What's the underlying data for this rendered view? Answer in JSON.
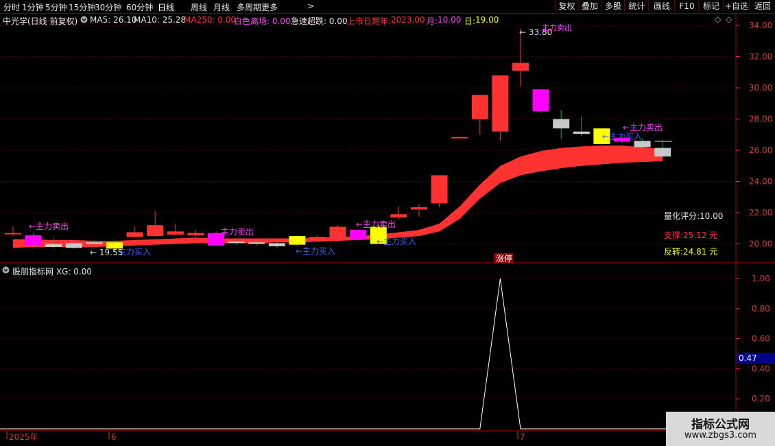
{
  "toolbar": {
    "tabs": [
      "分时",
      "1分钟",
      "5分钟",
      "15分钟",
      "30分钟",
      "60分钟",
      "日线",
      "周线",
      "月线",
      "多周期",
      "更多"
    ],
    "active": "日线",
    "more_arrow": ">",
    "buttons": [
      "复权",
      "叠加",
      "多股",
      "统计",
      "画线",
      "F10",
      "标记",
      "+自选",
      "返回"
    ]
  },
  "info": {
    "stock": "中光学(日线 前复权)",
    "ma5": "MA5: 26.10",
    "ma10": "MA10: 25.28",
    "ma250": "MA250: 0.00",
    "white_exit": "白色离场: 0.00",
    "sharp_drop": "急速超跌: 0.00",
    "listing_label": "上市日期年:",
    "listing_year": "2023.00",
    "month_label": "月:",
    "month": "10.00",
    "day_label": "日:",
    "day": "19.00"
  },
  "colors": {
    "up": "#ff3232",
    "down": "#00c0c0",
    "magenta": "#ff00ff",
    "yellow": "#ffff00",
    "gray": "#c8c8c8",
    "band": "#ff3232",
    "grid": "#8b0000",
    "axis_text": "#d23c3c",
    "label_magenta": "#ff40ff",
    "label_blue": "#3a5bff"
  },
  "main_axis": {
    "ticks": [
      "34.00",
      "32.00",
      "30.00",
      "28.00",
      "26.00",
      "24.00",
      "22.00",
      "20.00"
    ]
  },
  "indicator_axis": {
    "ticks": [
      "1.00",
      "0.80",
      "0.60",
      "0.40",
      "0.20"
    ],
    "current": "0.47"
  },
  "right_panel": {
    "score": "量化评分:10.00",
    "support": "支撑:25.12 元",
    "reversal": "反转:24.81 元"
  },
  "annotations": {
    "high": "33.80",
    "low": "19.55",
    "zhangting": "涨停",
    "sell": "←主力卖出",
    "buy": "←主力买入",
    "sell_top": "主力卖出"
  },
  "candles": [
    {
      "o": 20.7,
      "h": 21.1,
      "l": 20.55,
      "c": 20.7,
      "type": "flat"
    },
    {
      "o": 19.9,
      "h": 20.7,
      "l": 19.75,
      "c": 20.55,
      "type": "magenta"
    },
    {
      "o": 20.0,
      "h": 20.4,
      "l": 19.7,
      "c": 19.8,
      "type": "gray"
    },
    {
      "o": 20.05,
      "h": 20.15,
      "l": 19.7,
      "c": 19.75,
      "type": "gray"
    },
    {
      "o": 20.1,
      "h": 20.25,
      "l": 19.95,
      "c": 20.0,
      "type": "gray"
    },
    {
      "o": 19.7,
      "h": 20.3,
      "l": 19.55,
      "c": 20.1,
      "type": "yellow"
    },
    {
      "o": 20.45,
      "h": 21.1,
      "l": 20.4,
      "c": 20.75,
      "type": "flat"
    },
    {
      "o": 20.5,
      "h": 22.1,
      "l": 20.45,
      "c": 21.2,
      "type": "up"
    },
    {
      "o": 20.6,
      "h": 21.3,
      "l": 20.55,
      "c": 20.8,
      "type": "up"
    },
    {
      "o": 20.55,
      "h": 20.9,
      "l": 20.45,
      "c": 20.7,
      "type": "up"
    },
    {
      "o": 19.9,
      "h": 20.8,
      "l": 19.85,
      "c": 20.7,
      "type": "magenta"
    },
    {
      "o": 20.05,
      "h": 20.3,
      "l": 19.95,
      "c": 20.15,
      "type": "gray"
    },
    {
      "o": 20.0,
      "h": 20.2,
      "l": 19.9,
      "c": 20.1,
      "type": "gray"
    },
    {
      "o": 19.85,
      "h": 20.2,
      "l": 19.75,
      "c": 20.05,
      "type": "gray"
    },
    {
      "o": 19.95,
      "h": 20.55,
      "l": 19.85,
      "c": 20.5,
      "type": "yellow"
    },
    {
      "o": 20.3,
      "h": 20.55,
      "l": 20.25,
      "c": 20.45,
      "type": "up"
    },
    {
      "o": 20.3,
      "h": 21.2,
      "l": 20.25,
      "c": 21.1,
      "type": "up"
    },
    {
      "o": 20.3,
      "h": 20.9,
      "l": 20.25,
      "c": 20.9,
      "type": "magenta"
    },
    {
      "o": 20.0,
      "h": 21.3,
      "l": 20.0,
      "c": 21.1,
      "type": "yellow"
    },
    {
      "o": 21.7,
      "h": 22.4,
      "l": 21.55,
      "c": 21.9,
      "type": "up"
    },
    {
      "o": 22.2,
      "h": 22.55,
      "l": 21.75,
      "c": 22.35,
      "type": "up"
    },
    {
      "o": 22.6,
      "h": 24.4,
      "l": 22.35,
      "c": 24.4,
      "type": "up"
    },
    {
      "o": 26.85,
      "h": 26.85,
      "l": 26.85,
      "c": 26.85,
      "type": "flat"
    },
    {
      "o": 28.0,
      "h": 29.55,
      "l": 27.0,
      "c": 29.55,
      "type": "up"
    },
    {
      "o": 27.2,
      "h": 30.8,
      "l": 26.6,
      "c": 30.8,
      "type": "up"
    },
    {
      "o": 31.1,
      "h": 33.8,
      "l": 30.1,
      "c": 31.6,
      "type": "up"
    },
    {
      "o": 28.5,
      "h": 29.9,
      "l": 28.4,
      "c": 29.9,
      "type": "magenta"
    },
    {
      "o": 27.4,
      "h": 28.6,
      "l": 26.7,
      "c": 28.0,
      "type": "gray"
    },
    {
      "o": 27.05,
      "h": 28.2,
      "l": 26.9,
      "c": 27.2,
      "type": "gray"
    },
    {
      "o": 26.4,
      "h": 27.4,
      "l": 26.35,
      "c": 27.4,
      "type": "yellow"
    },
    {
      "o": 26.55,
      "h": 27.0,
      "l": 26.45,
      "c": 26.8,
      "type": "magenta"
    },
    {
      "o": 26.2,
      "h": 26.75,
      "l": 26.1,
      "c": 26.6,
      "type": "gray"
    },
    {
      "o": 25.6,
      "h": 26.65,
      "l": 25.5,
      "c": 26.15,
      "type": "gray"
    }
  ],
  "band_upper": [
    20.3,
    20.3,
    20.25,
    20.25,
    20.2,
    20.2,
    20.25,
    20.3,
    20.35,
    20.4,
    20.35,
    20.35,
    20.35,
    20.35,
    20.35,
    20.4,
    20.45,
    20.5,
    20.6,
    20.75,
    20.9,
    21.3,
    22.4,
    23.8,
    25.0,
    25.6,
    25.95,
    26.15,
    26.25,
    26.3,
    26.3,
    26.2,
    26.05
  ],
  "band_lower": [
    19.75,
    19.8,
    19.8,
    19.8,
    19.8,
    19.85,
    19.9,
    19.95,
    20.0,
    20.05,
    20.05,
    20.05,
    20.05,
    20.1,
    20.1,
    20.15,
    20.2,
    20.25,
    20.3,
    20.4,
    20.5,
    20.8,
    21.6,
    22.9,
    23.9,
    24.4,
    24.65,
    24.85,
    25.0,
    25.1,
    25.2,
    25.25,
    25.3
  ],
  "indicator": {
    "title": "股朋指标网 XG: 0.00",
    "spike_index": 24,
    "values": [
      0,
      0,
      0,
      0,
      0,
      0,
      0,
      0,
      0,
      0,
      0,
      0,
      0,
      0,
      0,
      0,
      0,
      0,
      0,
      0,
      0,
      0,
      0,
      0,
      1,
      0,
      0,
      0,
      0,
      0,
      0,
      0,
      0
    ]
  },
  "date_axis": {
    "year": "2025年",
    "m6": "6",
    "m7": "7"
  },
  "watermark": {
    "title": "指标公式网",
    "url": "www.zbgs3.com"
  }
}
